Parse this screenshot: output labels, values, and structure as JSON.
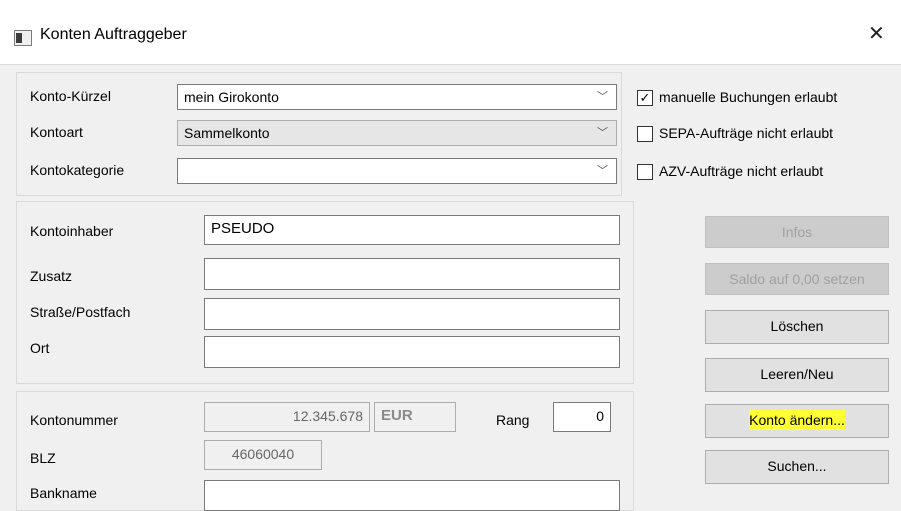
{
  "window": {
    "title": "Konten Auftraggeber"
  },
  "top": {
    "kuerzel_label": "Konto-Kürzel",
    "kuerzel_value": "mein Girokonto",
    "kontoart_label": "Kontoart",
    "kontoart_value": "Sammelkonto",
    "kategorie_label": "Kontokategorie",
    "kategorie_value": ""
  },
  "checkboxes": [
    {
      "label": "manuelle Buchungen erlaubt",
      "checked": true
    },
    {
      "label": "SEPA-Aufträge nicht erlaubt",
      "checked": false
    },
    {
      "label": "AZV-Aufträge nicht erlaubt",
      "checked": false
    }
  ],
  "owner": {
    "inhaber_label": "Kontoinhaber",
    "inhaber_value": "PSEUDO",
    "zusatz_label": "Zusatz",
    "zusatz_value": "",
    "strasse_label": "Straße/Postfach",
    "strasse_value": "",
    "ort_label": "Ort",
    "ort_value": ""
  },
  "account": {
    "nummer_label": "Kontonummer",
    "nummer_value": "12.345.678",
    "currency": "EUR",
    "rang_label": "Rang",
    "rang_value": "0",
    "blz_label": "BLZ",
    "blz_value": "46060040",
    "bankname_label": "Bankname",
    "bankname_value": ""
  },
  "buttons": {
    "infos": "Infos",
    "saldo": "Saldo auf 0,00 setzen",
    "loeschen": "Löschen",
    "leeren": "Leeren/Neu",
    "aendern": "Konto ändern...",
    "suchen": "Suchen..."
  },
  "icons": {
    "window": "app-window-icon",
    "close": "close-icon",
    "dropdown": "chevron-down-icon",
    "check": "checkmark-icon"
  },
  "colors": {
    "highlight": "#ffff33",
    "dialog_bg": "#f0f0f0"
  }
}
